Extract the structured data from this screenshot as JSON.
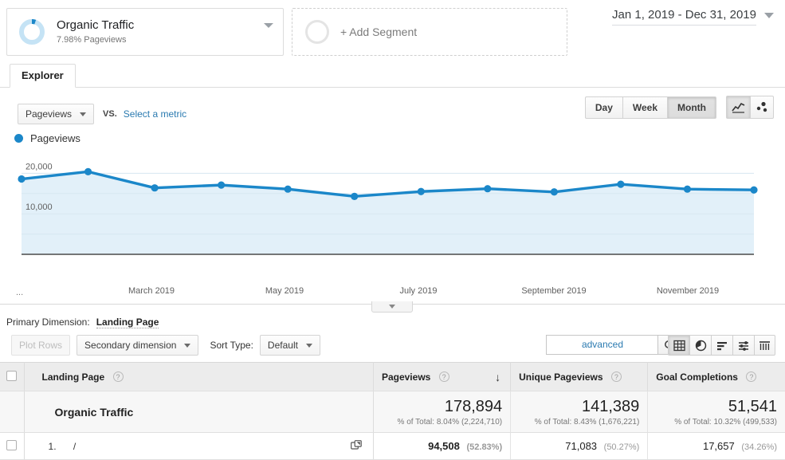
{
  "segment": {
    "name": "Organic Traffic",
    "subtitle": "7.98% Pageviews",
    "add_segment_label": "+ Add Segment",
    "donut_track_color": "#c5e3f5",
    "donut_arc_color": "#1b87c9"
  },
  "date_range": {
    "label": "Jan 1, 2019 - Dec 31, 2019"
  },
  "tabs": [
    {
      "label": "Explorer",
      "selected": true
    }
  ],
  "metric_toolbar": {
    "primary_metric": "Pageviews",
    "vs_label": "VS.",
    "select_metric_link": "Select a metric"
  },
  "granularity": {
    "options": [
      "Day",
      "Week",
      "Month"
    ],
    "selected": "Month"
  },
  "chart_view_icons": [
    {
      "name": "line-chart-icon",
      "selected": true
    },
    {
      "name": "motion-chart-icon",
      "selected": false
    }
  ],
  "chart_data": {
    "type": "line",
    "title": "Pageviews",
    "legend": [
      "Pageviews"
    ],
    "legend_position": "top-left",
    "legend_color": "#1b87c9",
    "line_color": "#1b87c9",
    "fill_color": "#e2f0f9",
    "grid": true,
    "xlabel": "",
    "ylabel": "",
    "ylim": [
      0,
      25000
    ],
    "yticks": [
      10000,
      20000
    ],
    "ytick_labels": [
      "10,000",
      "20,000"
    ],
    "x_axis_prefix": "...",
    "x_tick_labels": [
      "March 2019",
      "May 2019",
      "July 2019",
      "September 2019",
      "November 2019"
    ],
    "categories": [
      "January 2019",
      "February 2019",
      "March 2019",
      "April 2019",
      "May 2019",
      "June 2019",
      "July 2019",
      "August 2019",
      "September 2019",
      "October 2019",
      "November 2019",
      "December 2019"
    ],
    "values": [
      18600,
      20400,
      16400,
      17100,
      16100,
      14300,
      15500,
      16200,
      15400,
      17300,
      16100,
      15900
    ]
  },
  "primary_dimension": {
    "label": "Primary Dimension:",
    "value": "Landing Page"
  },
  "table_toolbar": {
    "plot_rows_label": "Plot Rows",
    "secondary_dimension_label": "Secondary dimension",
    "sort_type_label": "Sort Type:",
    "sort_type_value": "Default",
    "search_value": "",
    "search_placeholder": "",
    "advanced_link": "advanced",
    "view_icons": [
      {
        "name": "table-view-icon",
        "selected": true
      },
      {
        "name": "pie-chart-view-icon",
        "selected": false
      },
      {
        "name": "bar-chart-view-icon",
        "selected": false
      },
      {
        "name": "performance-view-icon",
        "selected": false
      },
      {
        "name": "pivot-view-icon",
        "selected": false
      }
    ]
  },
  "table": {
    "columns": [
      {
        "label": "Landing Page",
        "help": "?"
      },
      {
        "label": "Pageviews",
        "help": "?",
        "sorted": "desc"
      },
      {
        "label": "Unique Pageviews",
        "help": "?"
      },
      {
        "label": "Goal Completions",
        "help": "?"
      }
    ],
    "summary": {
      "label": "Organic Traffic",
      "metrics": [
        {
          "value": "178,894",
          "sub": "% of Total: 8.04% (2,224,710)"
        },
        {
          "value": "141,389",
          "sub": "% of Total: 8.43% (1,676,221)"
        },
        {
          "value": "51,541",
          "sub": "% of Total: 10.32% (499,533)"
        }
      ]
    },
    "rows": [
      {
        "index": "1.",
        "dimension": "/",
        "metrics": [
          {
            "value": "94,508",
            "pct": "(52.83%)"
          },
          {
            "value": "71,083",
            "pct": "(50.27%)"
          },
          {
            "value": "17,657",
            "pct": "(34.26%)"
          }
        ]
      }
    ]
  }
}
